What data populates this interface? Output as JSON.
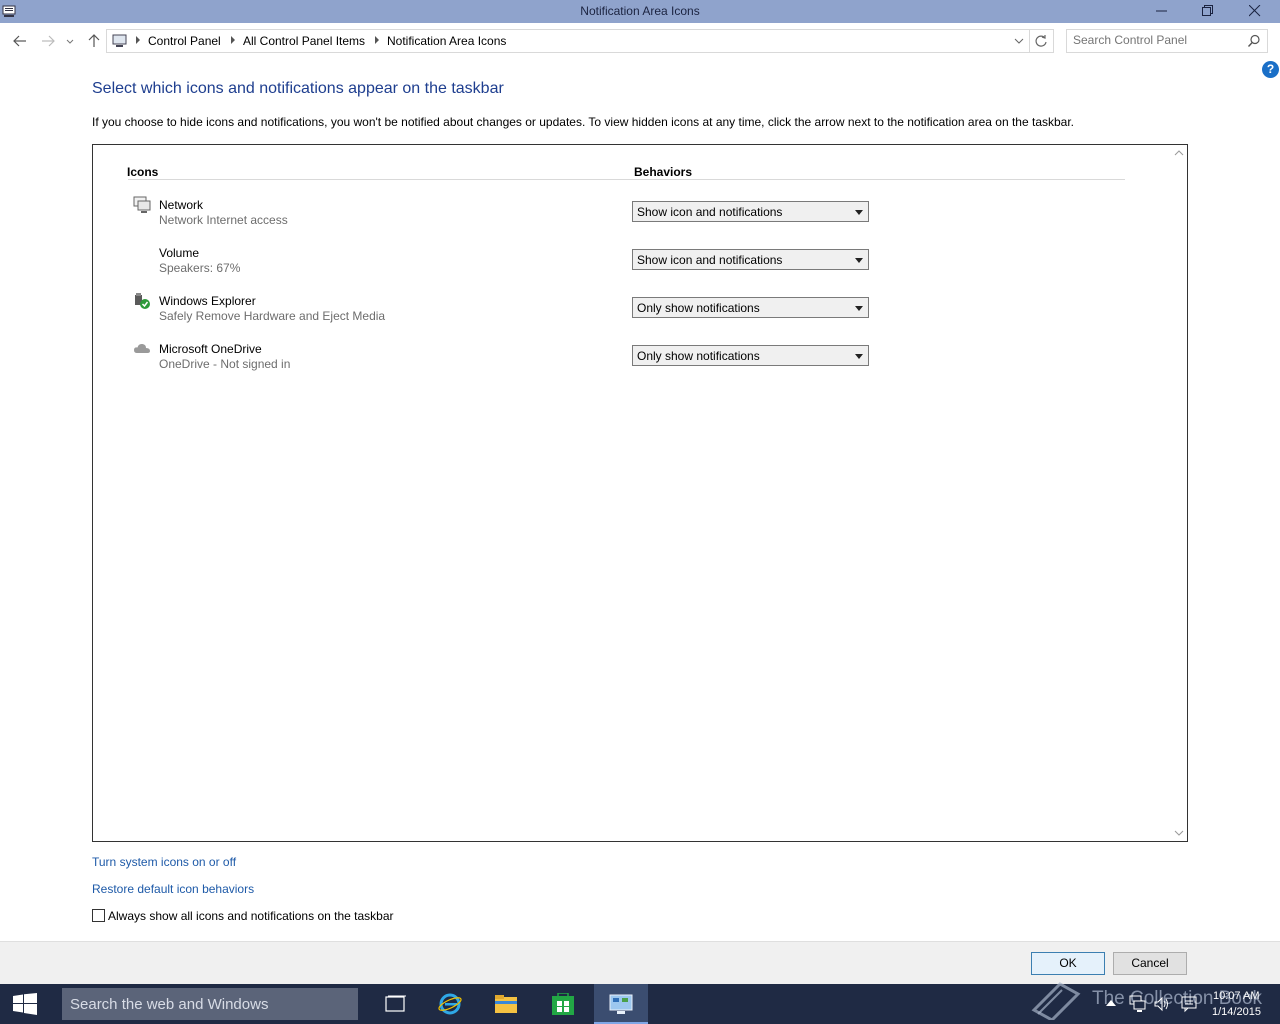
{
  "window": {
    "title": "Notification Area Icons"
  },
  "address": {
    "crumbs": [
      "Control Panel",
      "All Control Panel Items",
      "Notification Area Icons"
    ],
    "search_placeholder": "Search Control Panel"
  },
  "help_label": "?",
  "content": {
    "heading": "Select which icons and notifications appear on the taskbar",
    "description": "If you choose to hide icons and notifications, you won't be notified about changes or updates. To view hidden icons at any time, click the arrow next to the notification area on the taskbar.",
    "col_icons": "Icons",
    "col_behaviors": "Behaviors",
    "rows": [
      {
        "icon": "network-icon",
        "name": "Network",
        "sub": "Network Internet access",
        "behavior": "Show icon and notifications"
      },
      {
        "icon": "volume-icon",
        "name": "Volume",
        "sub": "Speakers: 67%",
        "behavior": "Show icon and notifications"
      },
      {
        "icon": "safely-remove-hardware-icon",
        "name": "Windows Explorer",
        "sub": "Safely Remove Hardware and Eject Media",
        "behavior": "Only show notifications"
      },
      {
        "icon": "onedrive-cloud-icon",
        "name": "Microsoft OneDrive",
        "sub": "OneDrive - Not signed in",
        "behavior": "Only show notifications"
      }
    ],
    "link_system_icons": "Turn system icons on or off",
    "link_restore": "Restore default icon behaviors",
    "checkbox_label": "Always show all icons and notifications on the taskbar",
    "checkbox_checked": false
  },
  "buttons": {
    "ok": "OK",
    "cancel": "Cancel"
  },
  "taskbar": {
    "search_placeholder": "Search the web and Windows",
    "watermark": "The Collection Book",
    "time": "10:07 AM",
    "date": "1/14/2015"
  },
  "colors": {
    "titlebar": "#8fa3cc",
    "heading": "#1e3e8f",
    "link": "#1e5aa8",
    "taskbar": "#1f2a44"
  }
}
